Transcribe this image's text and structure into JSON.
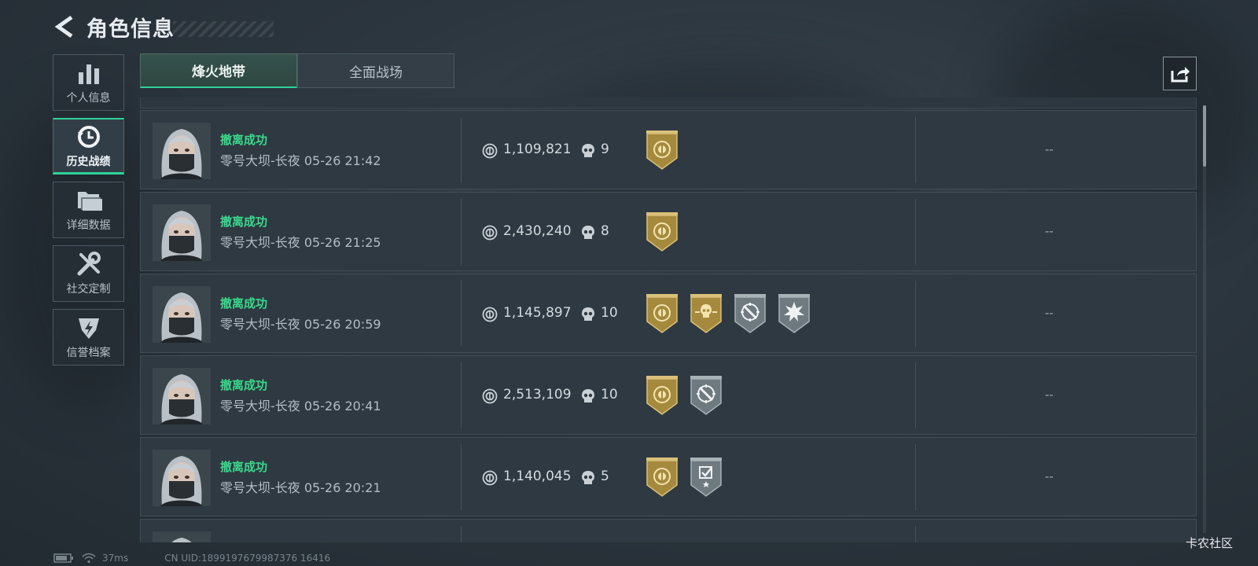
{
  "header": {
    "title": "角色信息"
  },
  "sidebar": {
    "items": [
      {
        "label": "个人信息",
        "icon": "bar-chart-icon",
        "active": false
      },
      {
        "label": "历史战绩",
        "icon": "history-clock-icon",
        "active": true
      },
      {
        "label": "详细数据",
        "icon": "folder-icon",
        "active": false
      },
      {
        "label": "社交定制",
        "icon": "tools-icon",
        "active": false
      },
      {
        "label": "信誉档案",
        "icon": "lightning-shield-icon",
        "active": false
      }
    ]
  },
  "tabs": [
    {
      "label": "烽火地带",
      "active": true
    },
    {
      "label": "全面战场",
      "active": false
    }
  ],
  "share": {
    "icon": "share-icon"
  },
  "matches": [
    {
      "status": "撤离成功",
      "map": "零号大坝-长夜",
      "time": "05-26 21:42",
      "value": "1,109,821",
      "kills": "9",
      "badges": [
        "gold-crest-badge"
      ],
      "extra": "--"
    },
    {
      "status": "撤离成功",
      "map": "零号大坝-长夜",
      "time": "05-26 21:25",
      "value": "2,430,240",
      "kills": "8",
      "badges": [
        "gold-crest-badge"
      ],
      "extra": "--"
    },
    {
      "status": "撤离成功",
      "map": "零号大坝-长夜",
      "time": "05-26 20:59",
      "value": "1,145,897",
      "kills": "10",
      "badges": [
        "gold-crest-badge",
        "gold-skull-badge",
        "crosshair-badge",
        "explosion-badge"
      ],
      "extra": "--"
    },
    {
      "status": "撤离成功",
      "map": "零号大坝-长夜",
      "time": "05-26 20:41",
      "value": "2,513,109",
      "kills": "10",
      "badges": [
        "gold-crest-badge",
        "crosshair-badge"
      ],
      "extra": "--"
    },
    {
      "status": "撤离成功",
      "map": "零号大坝-长夜",
      "time": "05-26 20:21",
      "value": "1,140,045",
      "kills": "5",
      "badges": [
        "gold-crest-badge",
        "checklist-badge"
      ],
      "extra": "--"
    }
  ],
  "statusbar": {
    "ping": "37ms",
    "uid": "CN UID:1899197679987376 16416"
  },
  "watermark": "卡农社区",
  "colors": {
    "accent": "#2fd29a",
    "success_text": "#39d98c",
    "gold": "#a58a3e"
  }
}
